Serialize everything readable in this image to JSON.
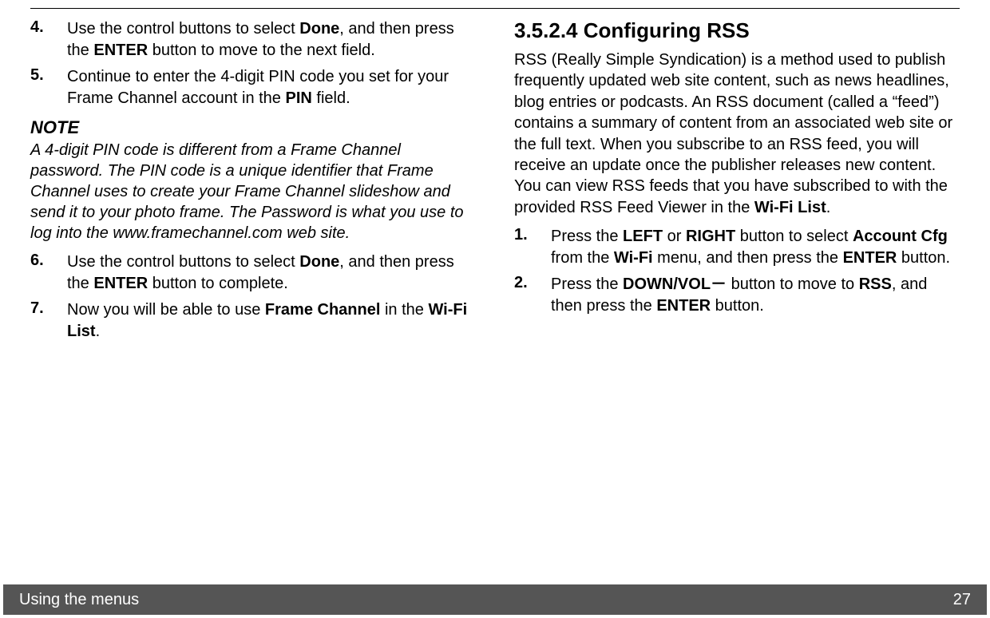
{
  "left": {
    "item4_num": "4.",
    "item4_a": "Use the control buttons to select ",
    "item4_b": "Done",
    "item4_c": ", and then press the ",
    "item4_d": "ENTER",
    "item4_e": " button to move to the next field.",
    "item5_num": "5.",
    "item5_a": "Continue to enter the 4-digit PIN code you set for your Frame Channel account in the ",
    "item5_b": "PIN",
    "item5_c": " field.",
    "note_heading": "NOTE",
    "note_body": "A 4-digit PIN code is different from a Frame Channel password. The PIN code is a unique identifier that Frame Channel uses to create your Frame Channel slideshow and send it to your photo frame. The Password is what you use to log into the www.framechannel.com web site.",
    "item6_num": "6.",
    "item6_a": "Use the control buttons to select ",
    "item6_b": "Done",
    "item6_c": ", and then press the ",
    "item6_d": "ENTER",
    "item6_e": " button to complete.",
    "item7_num": "7.",
    "item7_a": "Now you will be able to use ",
    "item7_b": "Frame Channel",
    "item7_c": " in the ",
    "item7_d": "Wi-Fi List",
    "item7_e": "."
  },
  "right": {
    "heading": "3.5.2.4 Configuring RSS",
    "para_a": "RSS (Really Simple Syndication) is a method used to publish frequently updated web site content, such as news headlines, blog entries or podcasts. An RSS document (called a “feed”) contains a summary of content from an associated web site or the full text. When you subscribe to an RSS feed, you will receive an update once the publisher releases new content. You can view RSS feeds that you have subscribed to with the provided RSS Feed Viewer in the ",
    "para_b": "Wi-Fi List",
    "para_c": ".",
    "item1_num": "1.",
    "item1_a": "Press the ",
    "item1_b": "LEFT",
    "item1_c": " or ",
    "item1_d": "RIGHT",
    "item1_e": " button to select ",
    "item1_f": "Account Cfg",
    "item1_g": " from the ",
    "item1_h": "Wi-Fi",
    "item1_i": " menu, and then press the ",
    "item1_j": "ENTER",
    "item1_k": " button.",
    "item2_num": "2.",
    "item2_a": "Press the ",
    "item2_b": "DOWN/VOL－",
    "item2_c": " button to move to ",
    "item2_d": "RSS",
    "item2_e": ", and then press the ",
    "item2_f": "ENTER",
    "item2_g": " button."
  },
  "footer": {
    "title": "Using the menus",
    "page": "27"
  }
}
